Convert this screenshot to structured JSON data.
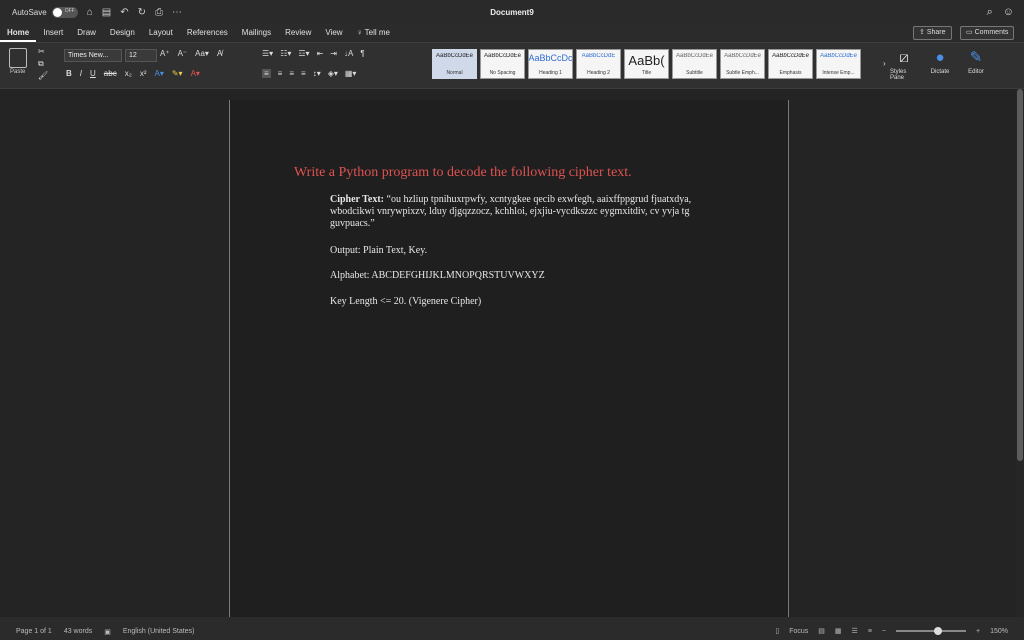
{
  "titlebar": {
    "autosave_label": "AutoSave",
    "autosave_state": "OFF",
    "document_title": "Document9"
  },
  "tabs": [
    {
      "label": "Home",
      "active": true
    },
    {
      "label": "Insert"
    },
    {
      "label": "Draw"
    },
    {
      "label": "Design"
    },
    {
      "label": "Layout"
    },
    {
      "label": "References"
    },
    {
      "label": "Mailings"
    },
    {
      "label": "Review"
    },
    {
      "label": "View"
    },
    {
      "label": "Tell me"
    }
  ],
  "header_buttons": {
    "share_label": "Share",
    "comments_label": "Comments"
  },
  "ribbon": {
    "paste_label": "Paste",
    "font_name": "Times New...",
    "font_size": "12",
    "styles": [
      {
        "sample": "AaBbCcDdEe",
        "name": "Normal"
      },
      {
        "sample": "AaBbCcDdEe",
        "name": "No Spacing"
      },
      {
        "sample": "AaBbCcDc",
        "name": "Heading 1"
      },
      {
        "sample": "AaBbCcDdE",
        "name": "Heading 2"
      },
      {
        "sample": "AaBb(",
        "name": "Title"
      },
      {
        "sample": "AaBbCcDdEe",
        "name": "Subtitle"
      },
      {
        "sample": "AaBbCcDdEe",
        "name": "Subtle Emph..."
      },
      {
        "sample": "AaBbCcDdEe",
        "name": "Emphasis"
      },
      {
        "sample": "AaBbCcDdEe",
        "name": "Intense Emp..."
      }
    ],
    "styles_pane_label": "Styles Pane",
    "dictate_label": "Dictate",
    "editor_label": "Editor"
  },
  "document": {
    "heading": "Write a Python program to decode the following cipher text.",
    "heading_color": "#e05252",
    "cipher_label": "Cipher Text:",
    "cipher_text": " “ou hzliup tpnihuxrpwfy, xcntygkee qecib exwfegh, aaixffppgrud fjuatxdya, wbodcikwi vnrywpixzv, lduy djgqzzocz, kchhloi, ejxjiu-vycdkszzc eygmxitdiv, cv yvja tg guvpuacs.”",
    "output_line": "Output: Plain Text, Key.",
    "alphabet_line": "Alphabet: ABCDEFGHIJKLMNOPQRSTUVWXYZ",
    "key_length_line": "Key Length <= 20. (Vigenere Cipher)"
  },
  "statusbar": {
    "page": "Page 1 of 1",
    "words": "43 words",
    "language": "English (United States)",
    "focus": "Focus",
    "zoom": "150%"
  }
}
